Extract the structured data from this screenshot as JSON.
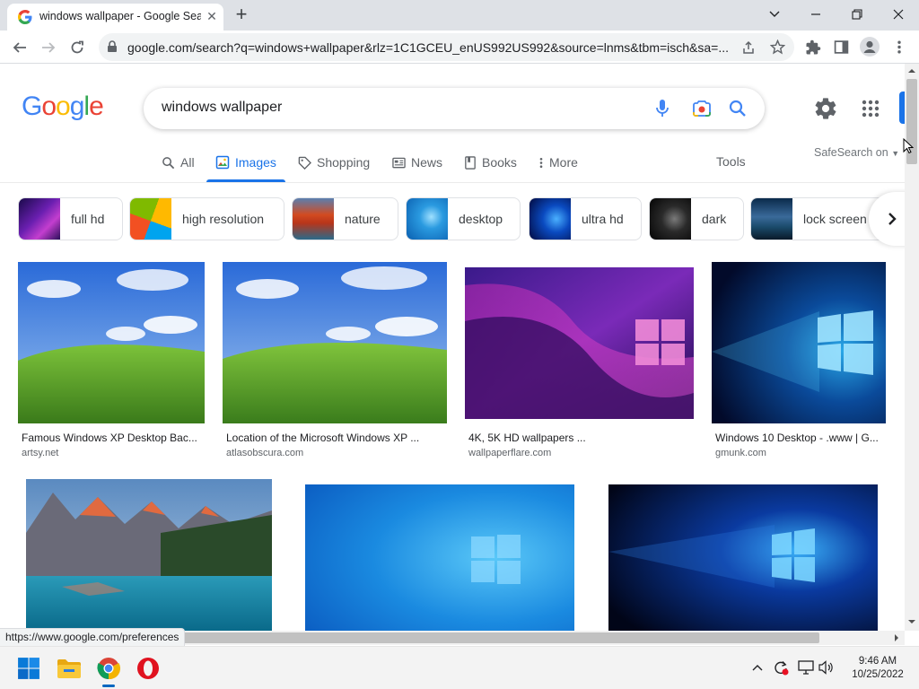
{
  "browser": {
    "tab_title": "windows wallpaper - Google Search",
    "url": "google.com/search?q=windows+wallpaper&rlz=1C1GCEU_enUS992US992&source=lnms&tbm=isch&sa=...",
    "status_url": "https://www.google.com/preferences"
  },
  "search": {
    "logo": "Google",
    "query": "windows wallpaper",
    "tools": "Tools",
    "safesearch": "SafeSearch on"
  },
  "nav": {
    "tabs": [
      {
        "label": "All",
        "icon": "search-icon"
      },
      {
        "label": "Images",
        "icon": "image-icon",
        "active": true
      },
      {
        "label": "Shopping",
        "icon": "tag-icon"
      },
      {
        "label": "News",
        "icon": "news-icon"
      },
      {
        "label": "Books",
        "icon": "book-icon"
      },
      {
        "label": "More",
        "icon": "more-vert-icon"
      }
    ]
  },
  "chips": [
    {
      "label": "full hd"
    },
    {
      "label": "high resolution"
    },
    {
      "label": "nature"
    },
    {
      "label": "desktop"
    },
    {
      "label": "ultra hd"
    },
    {
      "label": "dark"
    },
    {
      "label": "lock screen"
    }
  ],
  "results": [
    {
      "caption": "Famous Windows XP Desktop Bac...",
      "source": "artsy.net"
    },
    {
      "caption": "Location of the Microsoft Windows XP ...",
      "source": "atlasobscura.com"
    },
    {
      "caption": "4K, 5K HD wallpapers ...",
      "source": "wallpaperflare.com"
    },
    {
      "caption": "Windows 10 Desktop - .www | G...",
      "source": "gmunk.com"
    }
  ],
  "taskbar": {
    "time": "9:46 AM",
    "date": "10/25/2022"
  },
  "colors": {
    "accent": "#1a73e8",
    "google_blue": "#4285f4",
    "google_red": "#ea4335",
    "google_yellow": "#fbbc05",
    "google_green": "#34a853"
  }
}
